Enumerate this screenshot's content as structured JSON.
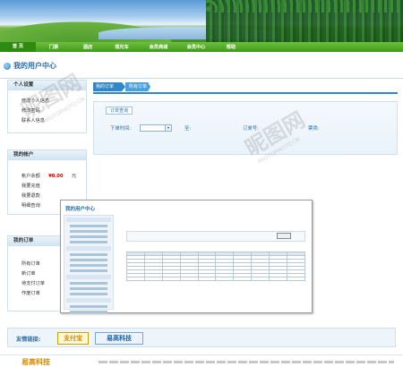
{
  "nav": {
    "items": [
      "首 页",
      "门票",
      "酒店",
      "观光车",
      "会员商城",
      "会员中心",
      "帮助"
    ]
  },
  "page_title": "我的用户中心",
  "sidebar": {
    "personal": {
      "title": "个人设置",
      "items": [
        "修改个人信息",
        "修改密码",
        "联系人信息"
      ]
    },
    "account": {
      "title": "我的帐户",
      "balance_label": "帐户余额",
      "balance_value": "¥0.00",
      "balance_unit": "元",
      "items": [
        "我要充值",
        "我要退款",
        "明细查询"
      ]
    },
    "orders": {
      "title": "我的订单",
      "items": [
        "所有订单",
        "新订单",
        "待支付订单",
        "作废订单"
      ]
    }
  },
  "tabs": {
    "first": "我的订单",
    "second": "所有订单"
  },
  "order_search": {
    "legend": "订单查询",
    "order_time_label": "下单时间:",
    "to_label": "至:",
    "order_no_label": "订单号:",
    "ticket_type_label": "票类:"
  },
  "preview": {
    "title": "我的用户中心"
  },
  "friends": {
    "label": "友情链接:",
    "links": [
      "支付宝",
      "易高科技"
    ]
  },
  "footer": {
    "logo": "易高科技"
  },
  "watermark": {
    "text": "昵图网",
    "url": "PHOTOPHOTO.CN"
  }
}
